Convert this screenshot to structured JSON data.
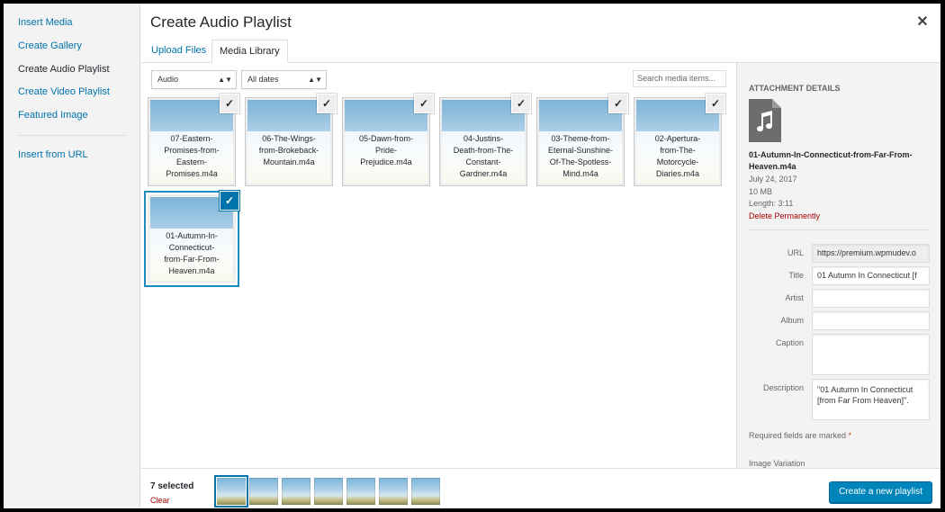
{
  "menu": {
    "items": [
      {
        "label": "Insert Media"
      },
      {
        "label": "Create Gallery"
      },
      {
        "label": "Create Audio Playlist"
      },
      {
        "label": "Create Video Playlist"
      },
      {
        "label": "Featured Image"
      },
      {
        "label": "Insert from URL"
      }
    ],
    "active": "Create Audio Playlist"
  },
  "header": {
    "title": "Create Audio Playlist",
    "close_icon": "close-icon",
    "tabs": [
      {
        "label": "Upload Files"
      },
      {
        "label": "Media Library"
      }
    ],
    "active_tab": "Media Library"
  },
  "toolbar": {
    "type_filter": {
      "selected": "Audio"
    },
    "date_filter": {
      "selected": "All dates"
    },
    "search": {
      "placeholder": "Search media items...",
      "value": ""
    }
  },
  "attachments": [
    {
      "lines": [
        "07-Eastern-",
        "Promises-from-",
        "Eastern-",
        "Promises.m4a"
      ],
      "selected": true,
      "focused": false
    },
    {
      "lines": [
        "06-The-Wings-",
        "from-Brokeback-",
        "Mountain.m4a"
      ],
      "selected": true,
      "focused": false
    },
    {
      "lines": [
        "05-Dawn-from-",
        "Pride-",
        "Prejudice.m4a"
      ],
      "selected": true,
      "focused": false
    },
    {
      "lines": [
        "04-Justins-",
        "Death-from-The-",
        "Constant-",
        "Gardner.m4a"
      ],
      "selected": true,
      "focused": false
    },
    {
      "lines": [
        "03-Theme-from-",
        "Eternal-Sunshine-",
        "Of-The-Spotless-",
        "Mind.m4a"
      ],
      "selected": true,
      "focused": false
    },
    {
      "lines": [
        "02-Apertura-",
        "from-The-",
        "Motorcycle-",
        "Diaries.m4a"
      ],
      "selected": true,
      "focused": false
    },
    {
      "lines": [
        "01-Autumn-In-",
        "Connecticut-",
        "from-Far-From-",
        "Heaven.m4a"
      ],
      "selected": true,
      "focused": true
    }
  ],
  "details": {
    "heading": "Attachment Details",
    "icon": "audio-file-icon",
    "filename": "01-Autumn-In-Connecticut-from-Far-From-Heaven.m4a",
    "date": "July 24, 2017",
    "size": "10 MB",
    "length": "Length: 3:11",
    "delete_label": "Delete Permanently",
    "fields": {
      "url": {
        "label": "URL",
        "value": "https://premium.wpmudev.o"
      },
      "title": {
        "label": "Title",
        "value": "01 Autumn In Connecticut [f"
      },
      "artist": {
        "label": "Artist",
        "value": ""
      },
      "album": {
        "label": "Album",
        "value": ""
      },
      "caption": {
        "label": "Caption",
        "value": ""
      },
      "description": {
        "label": "Description",
        "value": "\"01 Autumn In Connecticut [from Far From Heaven]\"."
      }
    },
    "required_note": "Required fields are marked",
    "required_star": "*",
    "image_variation": "Image Variation"
  },
  "bottom": {
    "count": "7 selected",
    "clear_label": "Clear",
    "button_label": "Create a new playlist",
    "selection_thumbs": 7
  },
  "colors": {
    "accent": "#0073aa",
    "button": "#0085ba",
    "delete": "#aa0000"
  }
}
